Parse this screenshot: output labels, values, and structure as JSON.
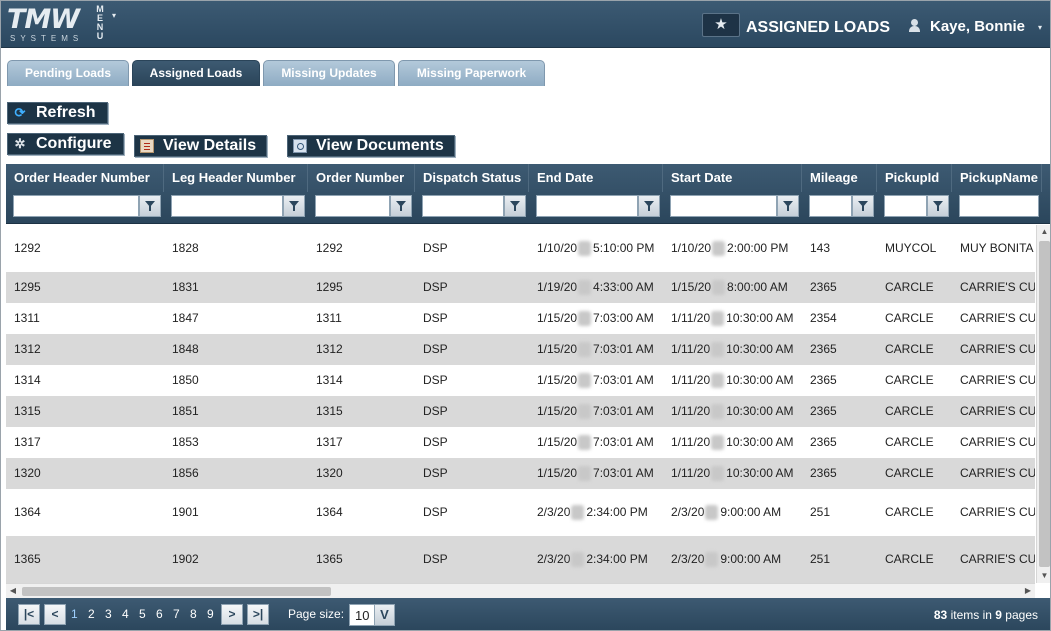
{
  "app": {
    "logo_main": "TMW",
    "logo_sub": "SYSTEMS",
    "menu_letters": [
      "M",
      "E",
      "N",
      "U"
    ],
    "menu_caret": "▾",
    "favorite_icon": "star-icon",
    "favorite_glyph": "★",
    "page_heading": "ASSIGNED LOADS",
    "user_name": "Kaye, Bonnie",
    "user_caret": "▾"
  },
  "tabs": [
    {
      "label": "Pending Loads",
      "active": false
    },
    {
      "label": "Assigned Loads",
      "active": true
    },
    {
      "label": "Missing Updates",
      "active": false
    },
    {
      "label": "Missing Paperwork",
      "active": false
    }
  ],
  "toolbar": {
    "refresh_label": "Refresh",
    "refresh_glyph": "⟳",
    "configure_label": "Configure",
    "configure_glyph": "✲",
    "view_details_label": "View Details",
    "view_documents_label": "View Documents"
  },
  "grid": {
    "columns": [
      "Order Header Number",
      "Leg Header Number",
      "Order Number",
      "Dispatch Status",
      "End Date",
      "Start Date",
      "Mileage",
      "PickupId",
      "PickupName"
    ],
    "rows": [
      {
        "ohn": "1292",
        "lhn": "1828",
        "on": "1292",
        "ds": "DSP",
        "end_a": "1/10/20",
        "end_b": "5:10:00 PM",
        "start_a": "1/10/20",
        "start_b": "2:00:00 PM",
        "mileage": "143",
        "pid": "MUYCOL",
        "pname": "MUY BONITA"
      },
      {
        "ohn": "1295",
        "lhn": "1831",
        "on": "1295",
        "ds": "DSP",
        "end_a": "1/19/20",
        "end_b": "4:33:00 AM",
        "start_a": "1/15/20",
        "start_b": "8:00:00 AM",
        "mileage": "2365",
        "pid": "CARCLE",
        "pname": "CARRIE'S CU"
      },
      {
        "ohn": "1311",
        "lhn": "1847",
        "on": "1311",
        "ds": "DSP",
        "end_a": "1/15/20",
        "end_b": "7:03:00 AM",
        "start_a": "1/11/20",
        "start_b": "10:30:00 AM",
        "mileage": "2354",
        "pid": "CARCLE",
        "pname": "CARRIE'S CU"
      },
      {
        "ohn": "1312",
        "lhn": "1848",
        "on": "1312",
        "ds": "DSP",
        "end_a": "1/15/20",
        "end_b": "7:03:01 AM",
        "start_a": "1/11/20",
        "start_b": "10:30:00 AM",
        "mileage": "2365",
        "pid": "CARCLE",
        "pname": "CARRIE'S CU"
      },
      {
        "ohn": "1314",
        "lhn": "1850",
        "on": "1314",
        "ds": "DSP",
        "end_a": "1/15/20",
        "end_b": "7:03:01 AM",
        "start_a": "1/11/20",
        "start_b": "10:30:00 AM",
        "mileage": "2365",
        "pid": "CARCLE",
        "pname": "CARRIE'S CU"
      },
      {
        "ohn": "1315",
        "lhn": "1851",
        "on": "1315",
        "ds": "DSP",
        "end_a": "1/15/20",
        "end_b": "7:03:01 AM",
        "start_a": "1/11/20",
        "start_b": "10:30:00 AM",
        "mileage": "2365",
        "pid": "CARCLE",
        "pname": "CARRIE'S CU"
      },
      {
        "ohn": "1317",
        "lhn": "1853",
        "on": "1317",
        "ds": "DSP",
        "end_a": "1/15/20",
        "end_b": "7:03:01 AM",
        "start_a": "1/11/20",
        "start_b": "10:30:00 AM",
        "mileage": "2365",
        "pid": "CARCLE",
        "pname": "CARRIE'S CU"
      },
      {
        "ohn": "1320",
        "lhn": "1856",
        "on": "1320",
        "ds": "DSP",
        "end_a": "1/15/20",
        "end_b": "7:03:01 AM",
        "start_a": "1/11/20",
        "start_b": "10:30:00 AM",
        "mileage": "2365",
        "pid": "CARCLE",
        "pname": "CARRIE'S CU"
      },
      {
        "ohn": "1364",
        "lhn": "1901",
        "on": "1364",
        "ds": "DSP",
        "end_a": "2/3/20",
        "end_b": "2:34:00 PM",
        "start_a": "2/3/20",
        "start_b": "9:00:00 AM",
        "mileage": "251",
        "pid": "CARCLE",
        "pname": "CARRIE'S CU"
      },
      {
        "ohn": "1365",
        "lhn": "1902",
        "on": "1365",
        "ds": "DSP",
        "end_a": "2/3/20",
        "end_b": "2:34:00 PM",
        "start_a": "2/3/20",
        "start_b": "9:00:00 AM",
        "mileage": "251",
        "pid": "CARCLE",
        "pname": "CARRIE'S CU"
      }
    ]
  },
  "pager": {
    "first": "|<",
    "prev": "<",
    "pages": [
      "1",
      "2",
      "3",
      "4",
      "5",
      "6",
      "7",
      "8",
      "9"
    ],
    "current_page": "1",
    "next": ">",
    "last": ">|",
    "page_size_label": "Page size:",
    "page_size_value": "10",
    "page_size_caret": "V",
    "items_count": "83",
    "items_mid": "items in",
    "pages_count": "9",
    "pages_word": "pages"
  },
  "colors": {
    "header_bg": "#2b4860",
    "tab_inactive": "#9db7cc",
    "row_alt": "#d9d9d9",
    "current_page": "#9fd0ff"
  }
}
